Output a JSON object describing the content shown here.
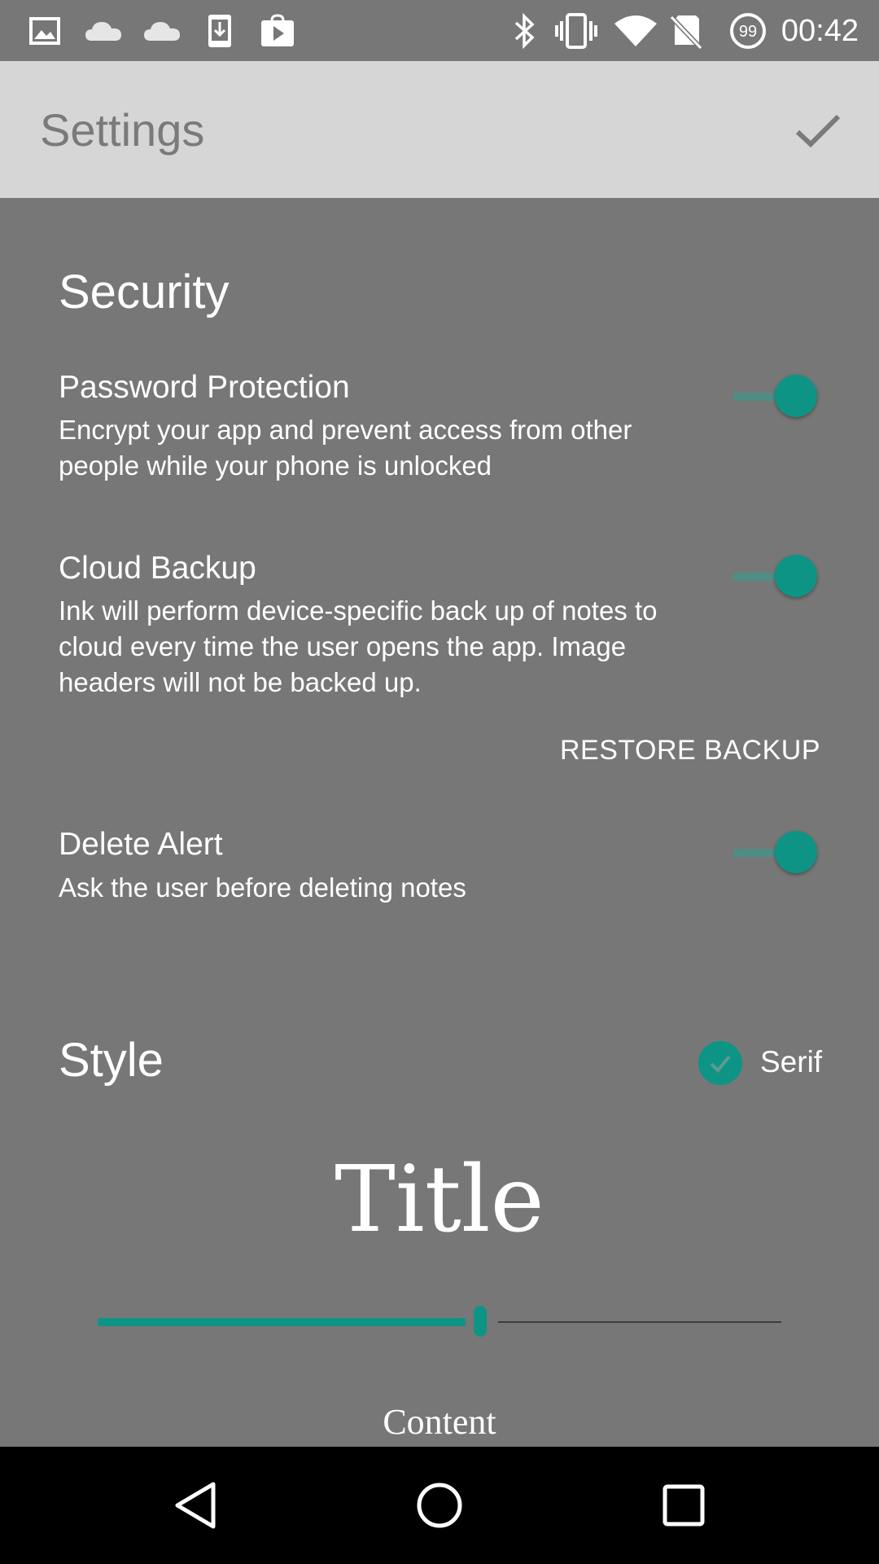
{
  "status_bar": {
    "time": "00:42",
    "battery_level_text": "99",
    "icons_left": [
      "image-icon",
      "cloud-icon",
      "cloud-icon",
      "download-icon",
      "play-store-icon"
    ],
    "icons_right": [
      "bluetooth-icon",
      "vibrate-icon",
      "wifi-icon",
      "no-sim-icon",
      "battery-icon"
    ]
  },
  "app_bar": {
    "title": "Settings",
    "confirm_icon": "check-icon"
  },
  "security": {
    "heading": "Security",
    "password_protection": {
      "title": "Password Protection",
      "summary": "Encrypt your app and prevent access from other people while your phone is unlocked",
      "enabled": true
    },
    "cloud_backup": {
      "title": "Cloud Backup",
      "summary": "Ink will perform device-specific back up of notes to cloud every time the user opens the app. Image headers will not be backed up.",
      "enabled": true,
      "restore_label": "RESTORE BACKUP"
    },
    "delete_alert": {
      "title": "Delete Alert",
      "summary": "Ask the user before deleting notes",
      "enabled": true
    }
  },
  "style": {
    "heading": "Style",
    "serif_label": "Serif",
    "serif_checked": true,
    "title_preview": "Title",
    "title_size_fraction": 0.56,
    "content_preview": "Content"
  },
  "colors": {
    "accent": "#0e9485",
    "background": "#777777",
    "app_bar": "#d6d6d6",
    "nav_bar": "#000000"
  },
  "nav_bar": {
    "back_icon": "back-triangle-icon",
    "home_icon": "home-circle-icon",
    "recents_icon": "recents-square-icon"
  }
}
